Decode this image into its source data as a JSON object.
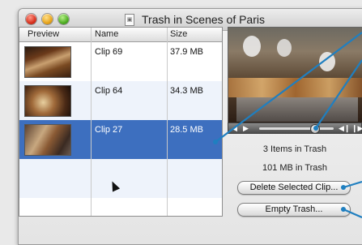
{
  "window": {
    "title": "Trash in Scenes of Paris"
  },
  "table": {
    "headers": {
      "preview": "Preview",
      "name": "Name",
      "size": "Size"
    },
    "rows": [
      {
        "name": "Clip 69",
        "size": "37.9 MB"
      },
      {
        "name": "Clip 64",
        "size": "34.3 MB"
      },
      {
        "name": "Clip 27",
        "size": "28.5 MB",
        "selected": true
      }
    ]
  },
  "info": {
    "item_count": "3 Items in Trash",
    "total_size": "101 MB in Trash"
  },
  "buttons": {
    "delete_selected": "Delete Selected Clip...",
    "empty_trash": "Empty Trash..."
  },
  "colors": {
    "selection": "#3d6fbf",
    "callout": "#1f7fc0"
  }
}
